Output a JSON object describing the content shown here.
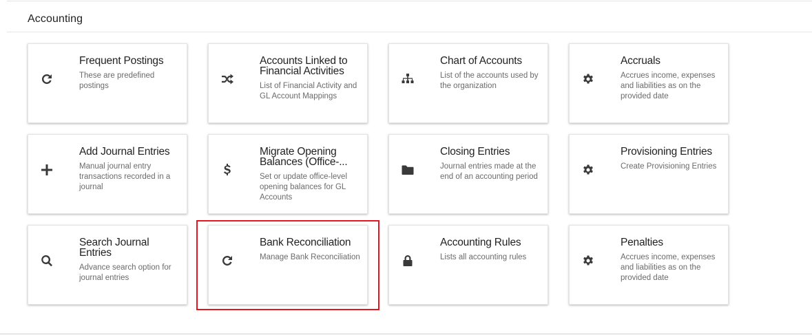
{
  "section": {
    "title": "Accounting"
  },
  "cards": [
    {
      "title": "Frequent Postings",
      "desc": "These are predefined postings",
      "icon": "refresh-icon"
    },
    {
      "title": "Accounts Linked to Financial Activities",
      "desc": "List of Financial Activity and GL Account Mappings",
      "icon": "shuffle-icon"
    },
    {
      "title": "Chart of Accounts",
      "desc": "List of the accounts used by the organization",
      "icon": "sitemap-icon"
    },
    {
      "title": "Accruals",
      "desc": "Accrues income, expenses and liabilities as on the provided date",
      "icon": "gear-icon"
    },
    {
      "title": "Add Journal Entries",
      "desc": "Manual journal entry transactions recorded in a journal",
      "icon": "plus-icon"
    },
    {
      "title": "Migrate Opening Balances (Office-...",
      "desc": "Set or update office-level opening balances for GL Accounts",
      "icon": "dollar-icon"
    },
    {
      "title": "Closing Entries",
      "desc": "Journal entries made at the end of an accounting period",
      "icon": "folder-icon"
    },
    {
      "title": "Provisioning Entries",
      "desc": "Create Provisioning Entries",
      "icon": "gear-icon"
    },
    {
      "title": "Search Journal Entries",
      "desc": "Advance search option for journal entries",
      "icon": "search-icon"
    },
    {
      "title": "Bank Reconciliation",
      "desc": "Manage Bank Reconciliation",
      "icon": "refresh-icon"
    },
    {
      "title": "Accounting Rules",
      "desc": "Lists all accounting rules",
      "icon": "lock-icon"
    },
    {
      "title": "Penalties",
      "desc": "Accrues income, expenses and liabilities as on the provided date",
      "icon": "gear-icon"
    }
  ],
  "highlight_color": "#e5161f"
}
